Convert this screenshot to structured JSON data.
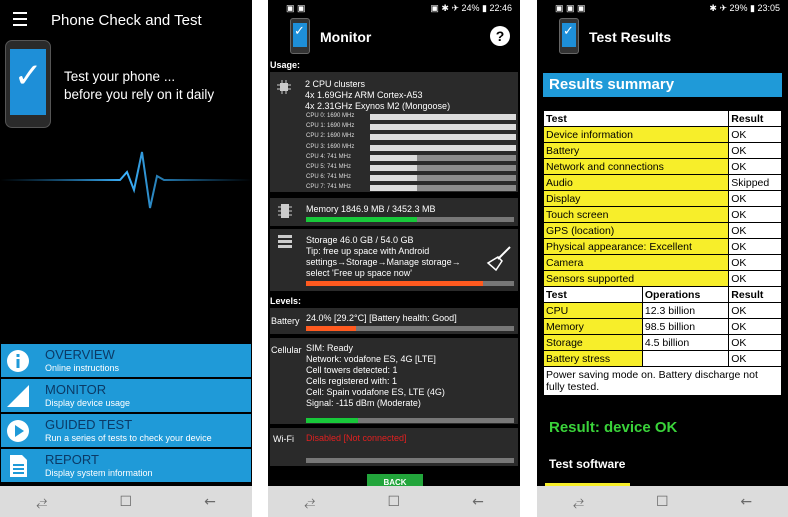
{
  "phone1": {
    "title": "Phone Check and Test",
    "tagline_1": "Test your phone ...",
    "tagline_2": "before you rely on it daily",
    "menu": [
      {
        "title": "OVERVIEW",
        "subtitle": "Online instructions"
      },
      {
        "title": "MONITOR",
        "subtitle": "Display device usage"
      },
      {
        "title": "GUIDED TEST",
        "subtitle": "Run a series of tests to check your device"
      },
      {
        "title": "REPORT",
        "subtitle": "Display system information"
      }
    ]
  },
  "phone2": {
    "status_left": "▣ ▣",
    "status_right": "▣ ✱ ✈ 24% ▮ 22:46",
    "title": "Monitor",
    "help": "?",
    "usage_label": "Usage:",
    "cpu_line_1": "2 CPU clusters",
    "cpu_line_2": "4x 1.69GHz ARM Cortex-A53",
    "cpu_line_3": "4x 2.31GHz Exynos M2 (Mongoose)",
    "cpus": [
      {
        "label": "CPU 0: 1690 MHz",
        "fill": 1.0
      },
      {
        "label": "CPU 1: 1690 MHz",
        "fill": 1.0
      },
      {
        "label": "CPU 2: 1690 MHz",
        "fill": 1.0
      },
      {
        "label": "CPU 3: 1690 MHz",
        "fill": 1.0
      },
      {
        "label": "CPU 4: 741 MHz",
        "fill": 0.32
      },
      {
        "label": "CPU 5: 741 MHz",
        "fill": 0.32
      },
      {
        "label": "CPU 6: 741 MHz",
        "fill": 0.32
      },
      {
        "label": "CPU 7: 741 MHz",
        "fill": 0.32
      }
    ],
    "memory_text": "Memory 1846.9 MB / 3452.3 MB",
    "memory_fill": 0.535,
    "storage_text": "Storage 46.0 GB / 54.0 GB",
    "storage_tip_1": "Tip: free up space with Android",
    "storage_tip_2": "settings→Storage→Manage storage→",
    "storage_tip_3": "select 'Free up space now'",
    "storage_fill": 0.85,
    "levels_label": "Levels:",
    "battery_label": "Battery",
    "battery_text": "24.0% [29.2°C] [Battery health: Good]",
    "battery_fill": 0.24,
    "cellular_label": "Cellular",
    "cellular_lines": [
      "SIM: Ready",
      "Network: vodafone ES, 4G [LTE]",
      "Cell towers detected: 1",
      "Cells registered with: 1",
      "Cell: Spain vodafone ES, LTE (4G)",
      "Signal: -115 dBm (Moderate)"
    ],
    "signal_fill": 0.25,
    "wifi_label": "Wi-Fi",
    "wifi_text": "Disabled [Not connected]",
    "back_label": "BACK"
  },
  "phone3": {
    "status_left": "▣ ▣ ▣",
    "status_right": "✱ ✈ 29% ▮ 23:05",
    "title": "Test Results",
    "summary": "Results summary",
    "test_header": "Test",
    "result_header": "Result",
    "tests": [
      {
        "name": "Device information",
        "result": "OK"
      },
      {
        "name": "Battery",
        "result": "OK"
      },
      {
        "name": "Network and connections",
        "result": "OK"
      },
      {
        "name": "Audio",
        "result": "Skipped"
      },
      {
        "name": "Display",
        "result": "OK"
      },
      {
        "name": "Touch screen",
        "result": "OK"
      },
      {
        "name": "GPS (location)",
        "result": "OK"
      },
      {
        "name": "Physical appearance: Excellent",
        "result": "OK"
      },
      {
        "name": "Camera",
        "result": "OK"
      },
      {
        "name": "Sensors supported",
        "result": "OK"
      }
    ],
    "ops_header": "Operations",
    "perf": [
      {
        "name": "CPU",
        "ops": "12.3 billion",
        "result": "OK"
      },
      {
        "name": "Memory",
        "ops": "98.5 billion",
        "result": "OK"
      },
      {
        "name": "Storage",
        "ops": "4.5 billion",
        "result": "OK"
      },
      {
        "name": "Battery stress",
        "ops": "",
        "result": "OK"
      }
    ],
    "note": "Power saving mode on. Battery discharge not fully tested.",
    "result_line": "Result: device OK",
    "software_label": "Test software"
  },
  "nav": {
    "recent": "⥄",
    "home": "☐",
    "back": "←"
  },
  "colors": {
    "accent": "#1f9ad8",
    "highlight": "#f7ee2a",
    "ok_green": "#3ad33a",
    "bar_orange": "#ff5a1f",
    "bar_green": "#18c83a",
    "wifi_red": "#e02020"
  }
}
